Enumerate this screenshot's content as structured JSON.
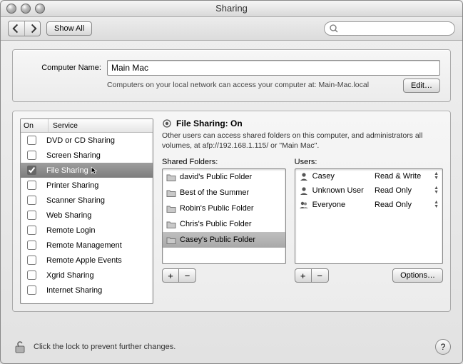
{
  "window": {
    "title": "Sharing"
  },
  "toolbar": {
    "show_all": "Show All",
    "search_placeholder": ""
  },
  "computer_name": {
    "label": "Computer Name:",
    "value": "Main Mac",
    "description": "Computers on your local network can access your computer at: Main-Mac.local",
    "edit_button": "Edit…"
  },
  "services": {
    "header_on": "On",
    "header_service": "Service",
    "items": [
      {
        "label": "DVD or CD Sharing",
        "on": false,
        "selected": false
      },
      {
        "label": "Screen Sharing",
        "on": false,
        "selected": false
      },
      {
        "label": "File Sharing",
        "on": true,
        "selected": true
      },
      {
        "label": "Printer Sharing",
        "on": false,
        "selected": false
      },
      {
        "label": "Scanner Sharing",
        "on": false,
        "selected": false
      },
      {
        "label": "Web Sharing",
        "on": false,
        "selected": false
      },
      {
        "label": "Remote Login",
        "on": false,
        "selected": false
      },
      {
        "label": "Remote Management",
        "on": false,
        "selected": false
      },
      {
        "label": "Remote Apple Events",
        "on": false,
        "selected": false
      },
      {
        "label": "Xgrid Sharing",
        "on": false,
        "selected": false
      },
      {
        "label": "Internet Sharing",
        "on": false,
        "selected": false
      }
    ]
  },
  "detail": {
    "status_title": "File Sharing: On",
    "description": "Other users can access shared folders on this computer, and administrators all volumes, at afp://192.168.1.115/ or \"Main Mac\".",
    "shared_folders_label": "Shared Folders:",
    "users_label": "Users:",
    "options_button": "Options…"
  },
  "shared_folders": [
    {
      "label": "david's Public Folder",
      "selected": false
    },
    {
      "label": "Best of the Summer",
      "selected": false
    },
    {
      "label": "Robin's Public Folder",
      "selected": false
    },
    {
      "label": "Chris's Public Folder",
      "selected": false
    },
    {
      "label": "Casey's Public Folder",
      "selected": true
    }
  ],
  "users": [
    {
      "icon": "person-icon",
      "name": "Casey",
      "permission": "Read & Write"
    },
    {
      "icon": "person-icon",
      "name": "Unknown User",
      "permission": "Read Only"
    },
    {
      "icon": "group-icon",
      "name": "Everyone",
      "permission": "Read Only"
    }
  ],
  "buttons": {
    "plus": "+",
    "minus": "−"
  },
  "footer": {
    "lock_text": "Click the lock to prevent further changes."
  }
}
